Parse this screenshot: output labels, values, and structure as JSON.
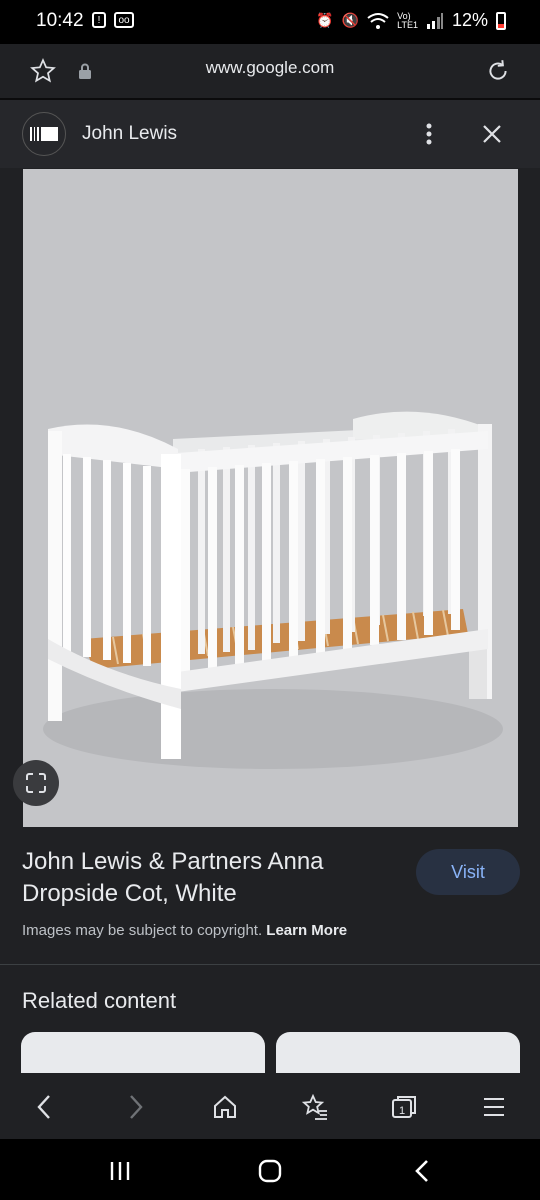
{
  "status_bar": {
    "time": "10:42",
    "battery": "12%"
  },
  "browser": {
    "url": "www.google.com"
  },
  "source": {
    "name": "John Lewis"
  },
  "result": {
    "title": "John Lewis & Partners Anna Dropside Cot, White",
    "visit_label": "Visit",
    "copyright_text": "Images may be subject to copyright.",
    "learn_more_label": "Learn More"
  },
  "related": {
    "heading": "Related content"
  },
  "icons": {
    "url_bar": [
      "star-icon",
      "lock-icon",
      "reload-icon"
    ],
    "header": [
      "more-vert-icon",
      "close-icon"
    ],
    "bottom_nav": [
      "back-icon",
      "forward-icon",
      "home-icon",
      "bookmarks-icon",
      "tabs-icon",
      "menu-icon"
    ],
    "tabs_count": "1"
  },
  "colors": {
    "accent": "#8ab4f8",
    "visit_bg": "#283142",
    "background": "#202124"
  }
}
